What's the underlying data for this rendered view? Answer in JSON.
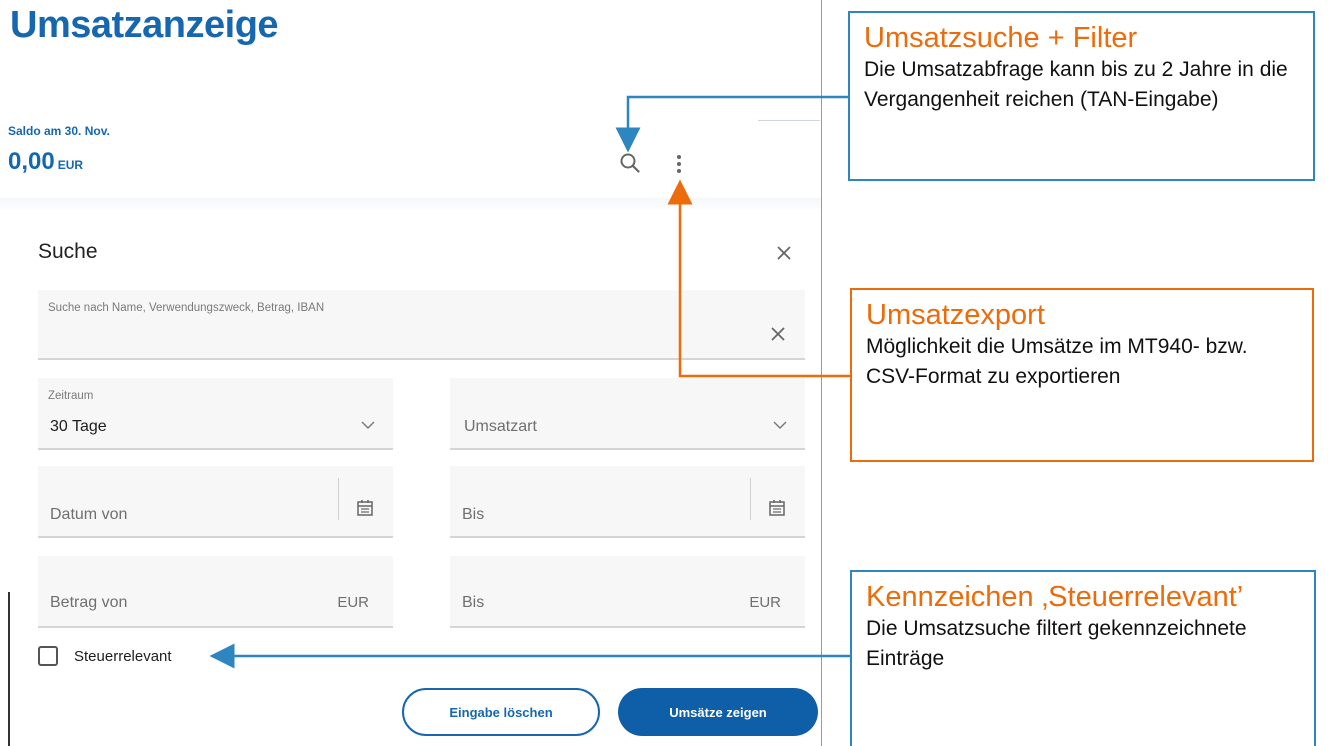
{
  "page": {
    "title": "Umsatzanzeige"
  },
  "balance": {
    "label": "Saldo am 30. Nov.",
    "amount": "0,00",
    "currency": "EUR"
  },
  "icons": {
    "search": "search-icon",
    "more": "more-vertical-icon",
    "close": "close-icon",
    "calendar": "calendar-icon",
    "chevron": "chevron-down-icon"
  },
  "search_panel": {
    "title": "Suche",
    "search_field": {
      "label": "Suche nach Name, Verwendungszweck, Betrag, IBAN",
      "value": ""
    },
    "zeitraum": {
      "label": "Zeitraum",
      "value": "30 Tage"
    },
    "umsatzart": {
      "placeholder": "Umsatzart"
    },
    "datum_von": {
      "placeholder": "Datum von"
    },
    "datum_bis": {
      "placeholder": "Bis"
    },
    "betrag_von": {
      "placeholder": "Betrag von",
      "currency": "EUR"
    },
    "betrag_bis": {
      "placeholder": "Bis",
      "currency": "EUR"
    },
    "steuerrelevant": {
      "label": "Steuerrelevant",
      "checked": false
    },
    "buttons": {
      "clear": "Eingabe löschen",
      "show": "Umsätze zeigen"
    }
  },
  "callouts": {
    "filter": {
      "title": "Umsatzsuche + Filter",
      "body": "Die Umsatzabfrage kann bis zu 2 Jahre in die Vergangenheit reichen (TAN-Eingabe)"
    },
    "export": {
      "title": "Umsatzexport",
      "body": "Möglichkeit die Umsätze im MT940- bzw. CSV-Format zu exportieren"
    },
    "tax": {
      "title": "Kennzeichen ‚Steuerrelevant’",
      "body": "Die Umsatzsuche filtert gekennzeichnete Einträge"
    }
  },
  "colors": {
    "brand_blue": "#1667b0",
    "primary_button": "#0f5fa8",
    "callout_orange": "#ec6b0b",
    "callout_blue": "#2e86c1"
  }
}
